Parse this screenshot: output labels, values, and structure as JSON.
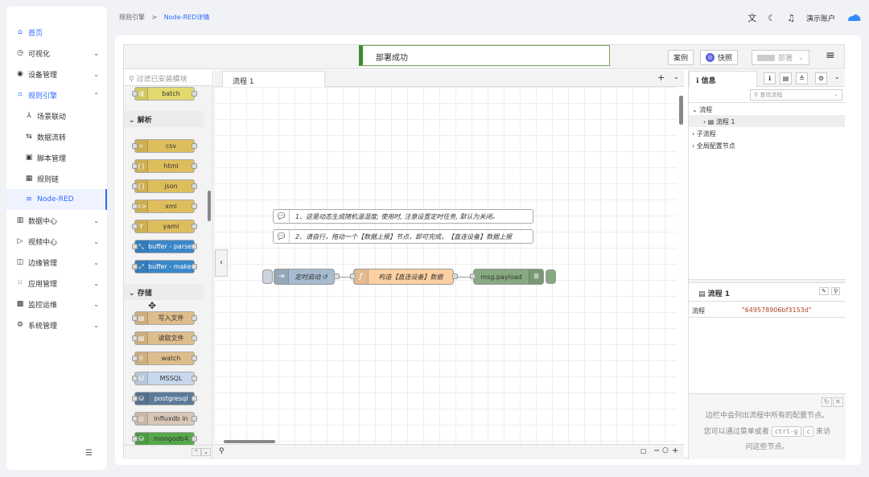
{
  "sidebar": {
    "items": [
      {
        "label": "首页",
        "icon": "home-icon",
        "glyph": "⌂",
        "arrow": ""
      },
      {
        "label": "可视化",
        "icon": "dashboard-icon",
        "glyph": "◷",
        "arrow": "⌄"
      },
      {
        "label": "设备管理",
        "icon": "device-icon",
        "glyph": "◉",
        "arrow": "⌄"
      },
      {
        "label": "规则引擎",
        "icon": "rule-icon",
        "glyph": "⌗",
        "arrow": "⌃"
      },
      {
        "label": "场景联动",
        "icon": "scene-icon",
        "glyph": "⅄",
        "arrow": ""
      },
      {
        "label": "数据流转",
        "icon": "transfer-icon",
        "glyph": "⇆",
        "arrow": ""
      },
      {
        "label": "脚本管理",
        "icon": "script-icon",
        "glyph": "▣",
        "arrow": ""
      },
      {
        "label": "规则链",
        "icon": "chain-icon",
        "glyph": "▦",
        "arrow": ""
      },
      {
        "label": "Node-RED",
        "icon": "nodered-icon",
        "glyph": "≡",
        "arrow": ""
      },
      {
        "label": "数据中心",
        "icon": "datacenter-icon",
        "glyph": "▥",
        "arrow": "⌄"
      },
      {
        "label": "视频中心",
        "icon": "video-icon",
        "glyph": "▷",
        "arrow": "⌄"
      },
      {
        "label": "边缘管理",
        "icon": "edge-icon",
        "glyph": "◫",
        "arrow": "⌄"
      },
      {
        "label": "应用管理",
        "icon": "app-icon",
        "glyph": "⁙",
        "arrow": "⌄"
      },
      {
        "label": "监控运维",
        "icon": "monitor-icon",
        "glyph": "▩",
        "arrow": "⌄"
      },
      {
        "label": "系统管理",
        "icon": "settings-icon",
        "glyph": "⚙",
        "arrow": "⌄"
      }
    ],
    "collapse": "☰"
  },
  "breadcrumb": {
    "parent": "规则引擎",
    "sep": ">",
    "current": "Node-RED详情"
  },
  "topbar": {
    "translate": "文",
    "theme": "☾",
    "bell": "♫",
    "account": "演示账户"
  },
  "nodered": {
    "deploy_msg": "部署成功",
    "btn_example": "案例",
    "btn_snapshot": "快照",
    "btn_deploy": "部署",
    "menu": "≡",
    "palette_search": "过滤已安装模块",
    "categories": {
      "parse": "解析",
      "storage": "存储"
    },
    "palette_nodes": {
      "batch": "batch",
      "csv": "csv",
      "html": "html",
      "json": "json",
      "xml": "xml",
      "yaml": "yaml",
      "buffer_parser": "buffer - parser",
      "buffer_maker": "buffer - maker",
      "write_file": "写入文件",
      "read_file": "读取文件",
      "watch": "watch",
      "mssql": "MSSQL",
      "postgresql": "postgresql",
      "influxdb": "influxdb in",
      "mongodb": "mongodb4"
    },
    "tab": "流程 1",
    "comments": [
      "1、这是动态生成随机温湿度; 使用时, 注意设置定时任务, 默认为关闭。",
      "2、请自行，拖动一个【数据上报】节点，即可完成，【直连设备】数据上报"
    ],
    "flow_nodes": {
      "inject": "定时启动 ↺",
      "function": "构造【直连设备】数据",
      "debug": "msg.payload"
    },
    "sidebar": {
      "tab_info": "信息",
      "search_placeholder": "查找流程",
      "tree": {
        "flows": "流程",
        "flow1": "流程 1",
        "subflows": "子流程",
        "config": "全局配置节点"
      },
      "info_title": "流程 1",
      "info_key": "流程",
      "info_value": "\"649578906bf3153d\"",
      "help_line1": "边栏中会列出流程中所有的配置节点。",
      "help_line2a": "您可以通过菜单或者",
      "help_kbd1": "ctrl-g",
      "help_kbd2": "c",
      "help_line2b": "来访",
      "help_line3": "问这些节点。"
    }
  },
  "colors": {
    "accent": "#2f6bff",
    "success": "#3d8c2b"
  }
}
